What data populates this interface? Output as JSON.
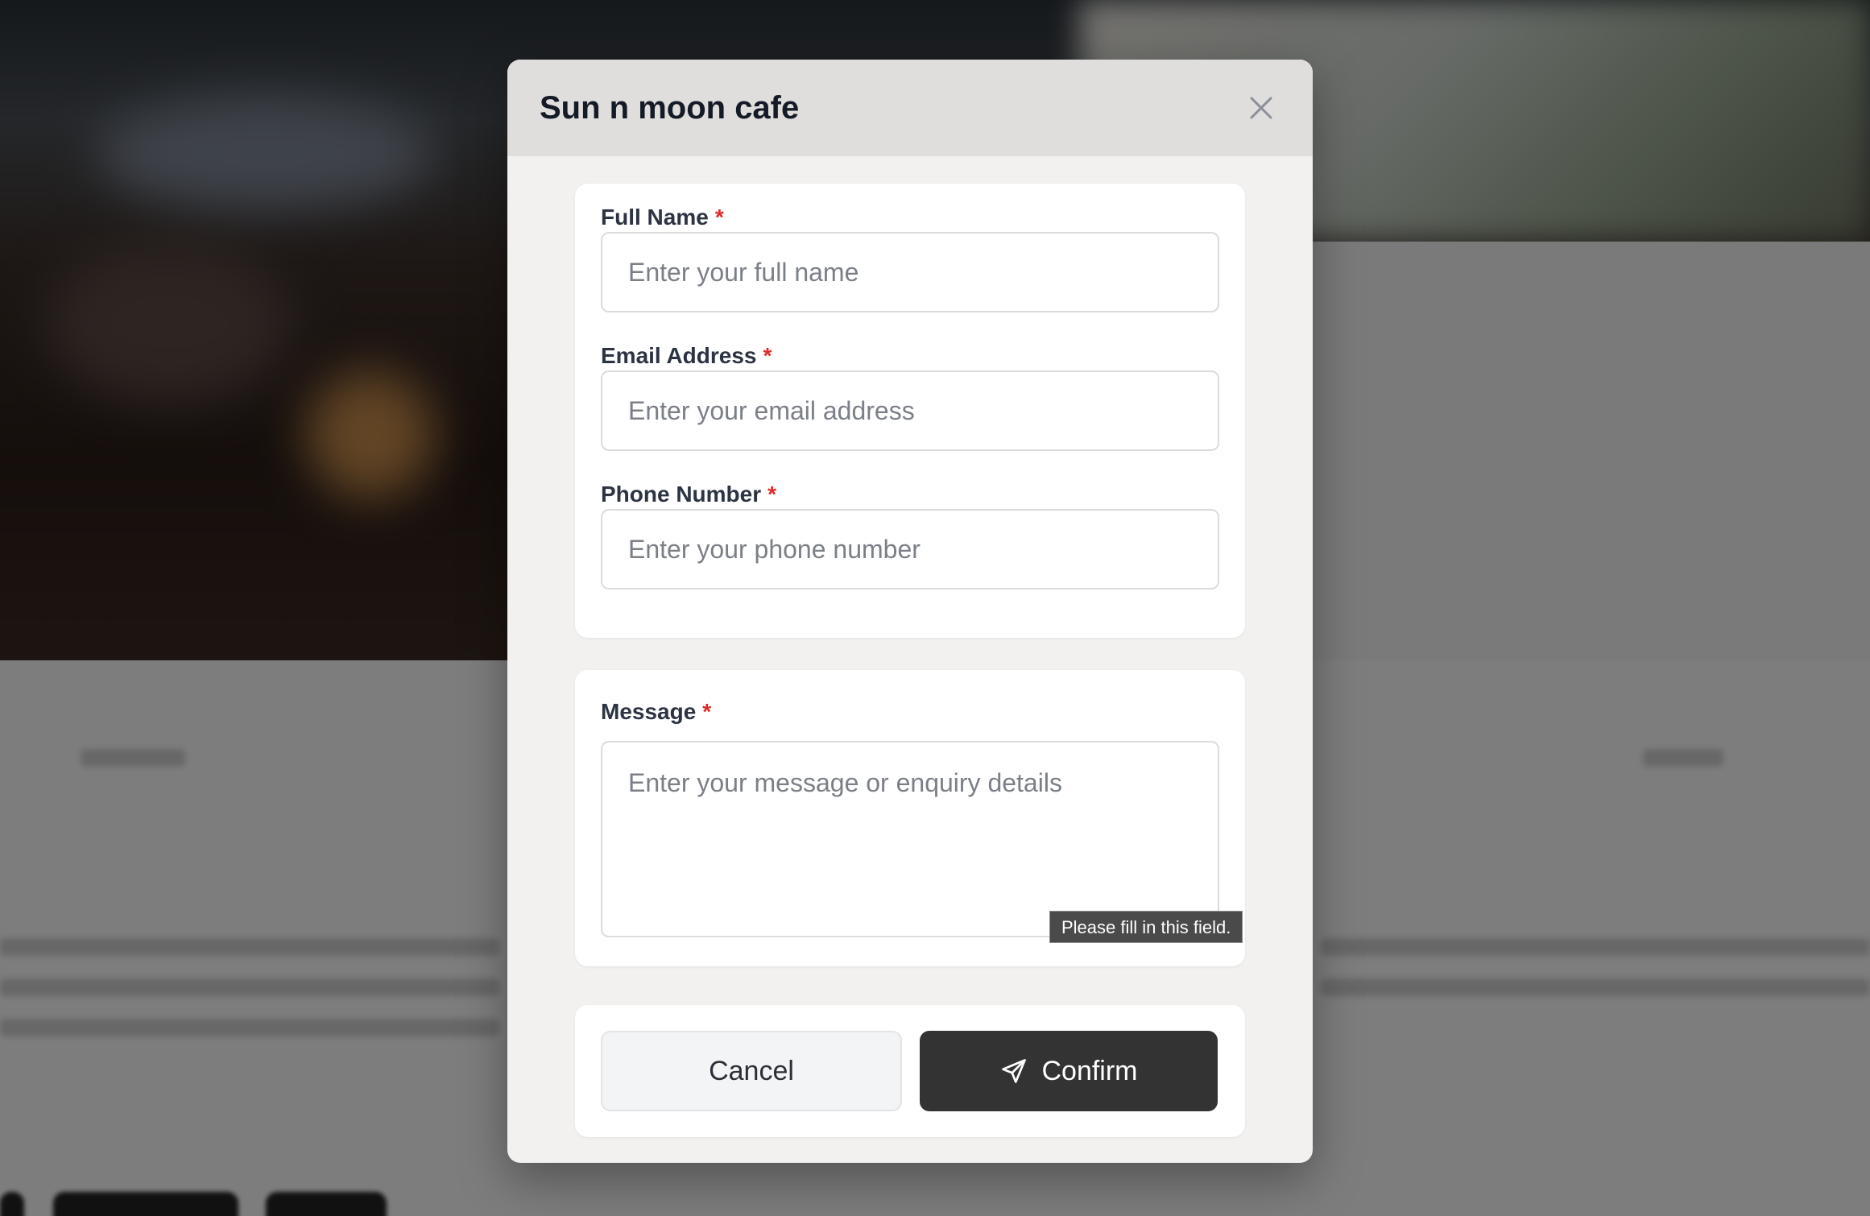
{
  "modal": {
    "title": "Sun n moon cafe",
    "close_icon": "close-icon"
  },
  "form": {
    "full_name": {
      "label": "Full Name",
      "required_mark": "*",
      "placeholder": "Enter your full name",
      "value": ""
    },
    "email": {
      "label": "Email Address",
      "required_mark": "*",
      "placeholder": "Enter your email address",
      "value": ""
    },
    "phone": {
      "label": "Phone Number",
      "required_mark": "*",
      "placeholder": "Enter your phone number",
      "value": ""
    },
    "message": {
      "label": "Message",
      "required_mark": "*",
      "placeholder": "Enter your message or enquiry details",
      "value": ""
    },
    "validation_tooltip": "Please fill in this field."
  },
  "actions": {
    "cancel_label": "Cancel",
    "confirm_label": "Confirm",
    "confirm_icon": "send-icon"
  },
  "colors": {
    "required": "#e02b2b",
    "confirm_bg": "#333333",
    "header_bg": "#dfdedc",
    "modal_bg": "#f2f1ef"
  }
}
